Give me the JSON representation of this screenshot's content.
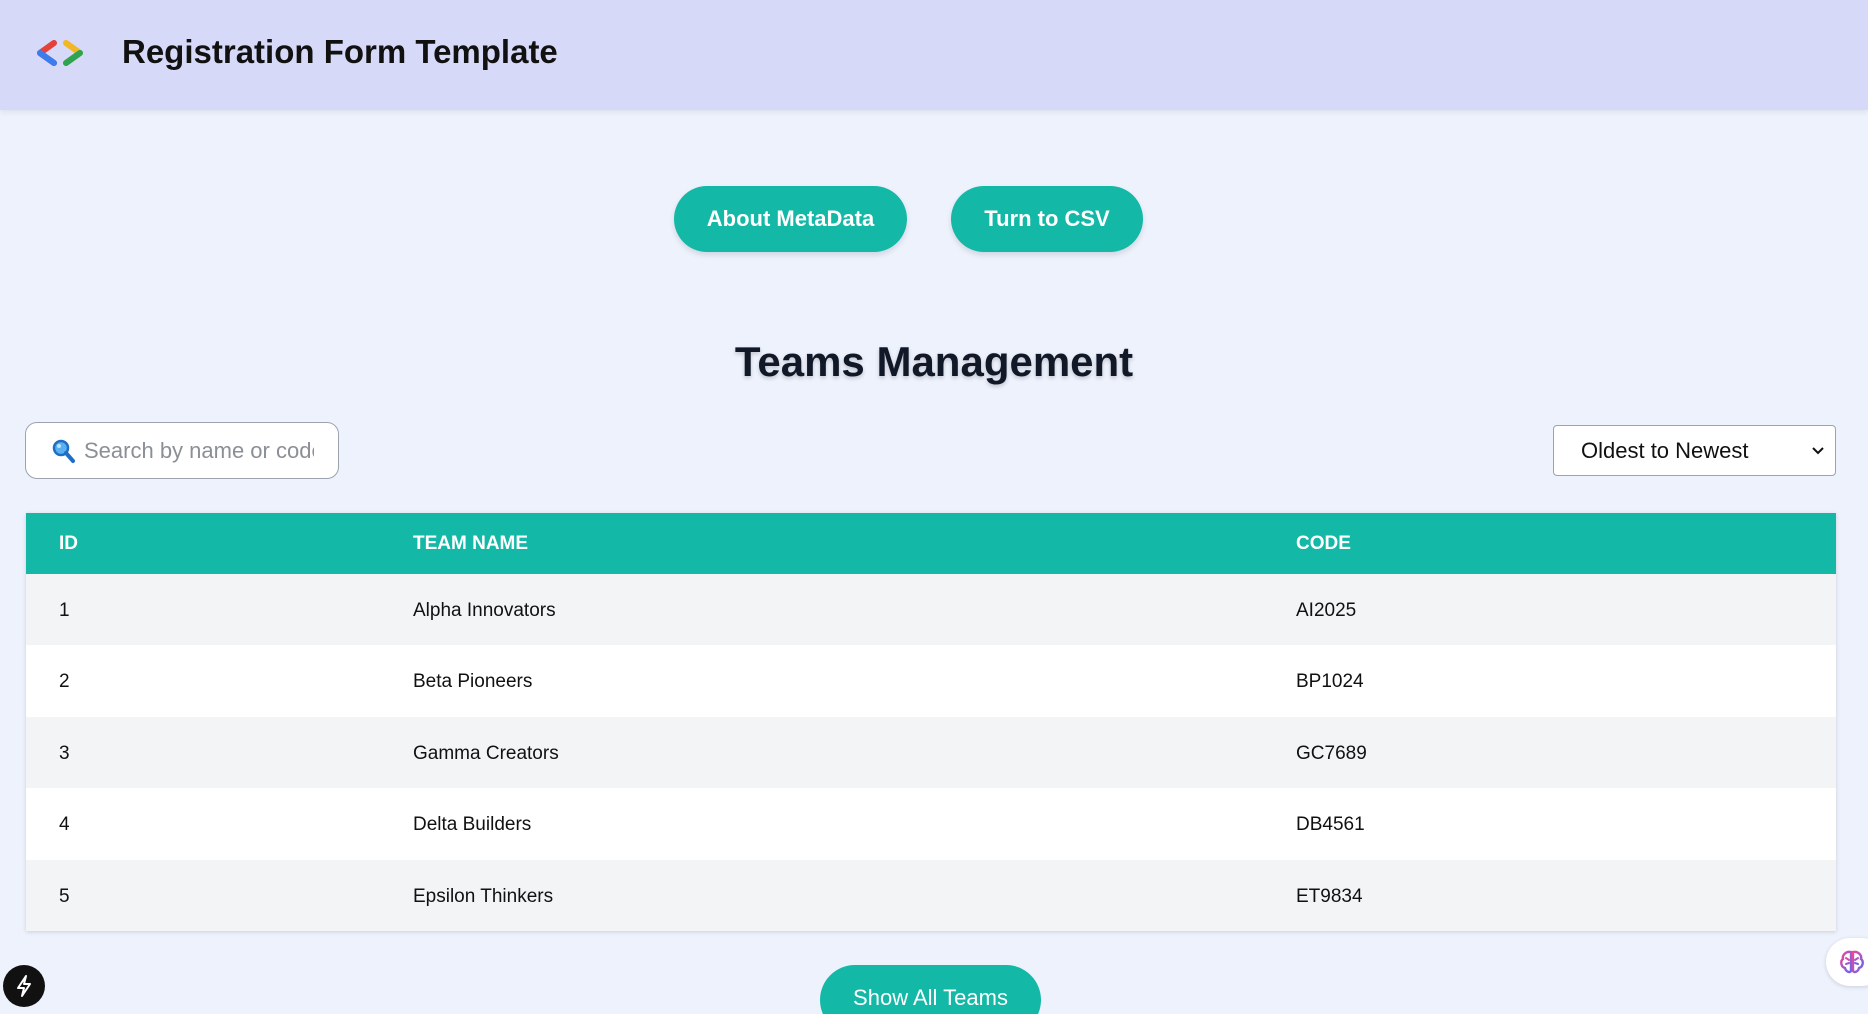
{
  "header": {
    "title": "Registration Form Template",
    "logo_icon": "code-brackets-logo"
  },
  "actions": {
    "about_label": "About MetaData",
    "csv_label": "Turn to CSV"
  },
  "page_title": "Teams Management",
  "search": {
    "placeholder": "Search by name or code",
    "value": "",
    "icon": "magnifier-icon"
  },
  "sort": {
    "selected": "Oldest to Newest"
  },
  "table": {
    "headers": [
      "ID",
      "TEAM NAME",
      "CODE"
    ],
    "rows": [
      {
        "id": "1",
        "name": "Alpha Innovators",
        "code": "AI2025"
      },
      {
        "id": "2",
        "name": "Beta Pioneers",
        "code": "BP1024"
      },
      {
        "id": "3",
        "name": "Gamma Creators",
        "code": "GC7689"
      },
      {
        "id": "4",
        "name": "Delta Builders",
        "code": "DB4561"
      },
      {
        "id": "5",
        "name": "Epsilon Thinkers",
        "code": "ET9834"
      }
    ]
  },
  "show_all_label": "Show All Teams",
  "colors": {
    "header_bg": "#d6d9f8",
    "page_bg": "#eef2fd",
    "accent": "#14b8a6"
  }
}
